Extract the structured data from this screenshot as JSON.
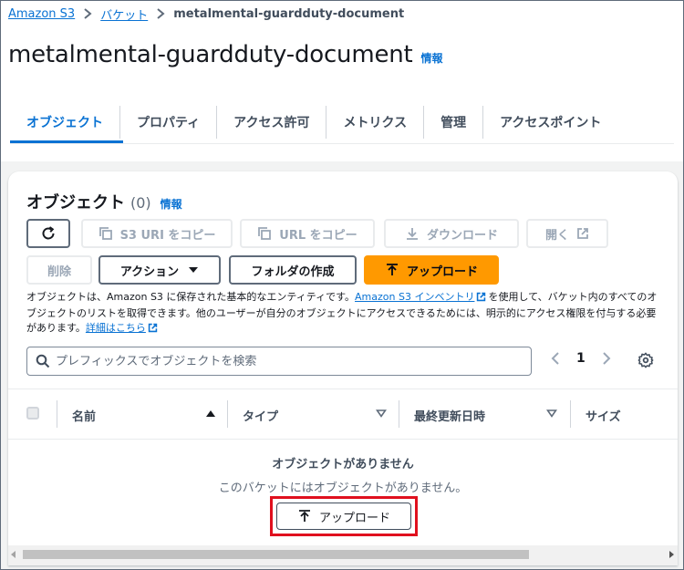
{
  "breadcrumb": {
    "items": [
      "Amazon S3",
      "バケット"
    ],
    "current": "metalmental-guardduty-document"
  },
  "page": {
    "title": "metalmental-guardduty-document",
    "info": "情報"
  },
  "tabs": [
    {
      "label": "オブジェクト",
      "active": true
    },
    {
      "label": "プロパティ"
    },
    {
      "label": "アクセス許可"
    },
    {
      "label": "メトリクス"
    },
    {
      "label": "管理"
    },
    {
      "label": "アクセスポイント"
    }
  ],
  "objects": {
    "title": "オブジェクト",
    "count": "(0)",
    "info": "情報",
    "buttons": {
      "copy_s3_uri": "S3 URI をコピー",
      "copy_url": "URL をコピー",
      "download": "ダウンロード",
      "open": "開く",
      "delete": "削除",
      "actions": "アクション",
      "create_folder": "フォルダの作成",
      "upload": "アップロード"
    },
    "description": {
      "part1": "オブジェクトは、Amazon S3 に保存された基本的なエンティティです。",
      "link1": "Amazon S3 インベントリ",
      "part2": "を使用して、バケット内のすべてのオブジェクトのリストを取得できます。他のユーザーが自分のオブジェクトにアクセスできるためには、明示的にアクセス権限を付与する必要があります。",
      "link2": "詳細はこちら"
    },
    "search": {
      "placeholder": "プレフィックスでオブジェクトを検索"
    },
    "pagination": {
      "page": "1"
    },
    "columns": [
      "名前",
      "タイプ",
      "最終更新日時",
      "サイズ"
    ],
    "empty": {
      "title": "オブジェクトがありません",
      "subtitle": "このバケットにはオブジェクトがありません。",
      "upload": "アップロード"
    }
  },
  "colors": {
    "accent": "#0972d3",
    "primary_button": "#ff9900",
    "highlight": "#e0101e"
  }
}
